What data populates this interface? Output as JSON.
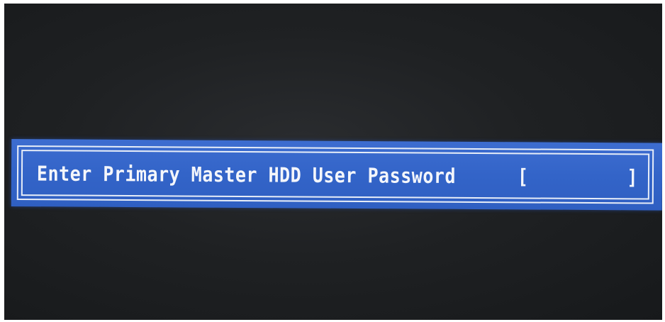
{
  "password_prompt": {
    "label": "Enter Primary Master HDD User Password",
    "bracket_open": "[",
    "bracket_close": "]",
    "value": ""
  },
  "colors": {
    "screen_background": "#1f2123",
    "dialog_background": "#3364c8",
    "frame_color": "#e8eef8",
    "text_color": "#f4f6fb"
  }
}
